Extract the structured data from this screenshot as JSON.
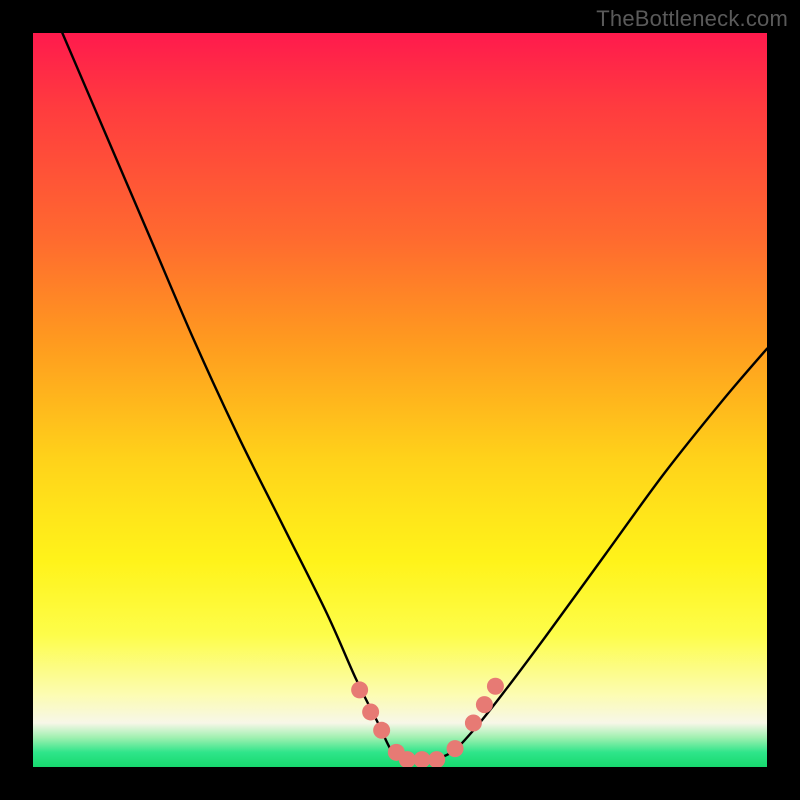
{
  "watermark": "TheBottleneck.com",
  "chart_data": {
    "type": "line",
    "title": "",
    "xlabel": "",
    "ylabel": "",
    "xlim": [
      0,
      100
    ],
    "ylim": [
      0,
      100
    ],
    "series": [
      {
        "name": "bottleneck-curve",
        "x": [
          4,
          10,
          16,
          22,
          28,
          34,
          40,
          44,
          47,
          49,
          51,
          54,
          57,
          60,
          64,
          70,
          78,
          86,
          94,
          100
        ],
        "y": [
          100,
          86,
          72,
          58,
          45,
          33,
          21,
          12,
          6,
          2,
          1,
          1,
          2,
          5,
          10,
          18,
          29,
          40,
          50,
          57
        ]
      }
    ],
    "markers": {
      "name": "highlight-dots",
      "color": "#e77a74",
      "points": [
        {
          "x": 44.5,
          "y": 10.5
        },
        {
          "x": 46.0,
          "y": 7.5
        },
        {
          "x": 47.5,
          "y": 5.0
        },
        {
          "x": 49.5,
          "y": 2.0
        },
        {
          "x": 51.0,
          "y": 1.0
        },
        {
          "x": 53.0,
          "y": 1.0
        },
        {
          "x": 55.0,
          "y": 1.0
        },
        {
          "x": 57.5,
          "y": 2.5
        },
        {
          "x": 60.0,
          "y": 6.0
        },
        {
          "x": 61.5,
          "y": 8.5
        },
        {
          "x": 63.0,
          "y": 11.0
        }
      ]
    },
    "background_gradient": [
      {
        "stop": 0.0,
        "color": "#ff1a4d"
      },
      {
        "stop": 0.28,
        "color": "#ff6a2f"
      },
      {
        "stop": 0.58,
        "color": "#ffd21a"
      },
      {
        "stop": 0.9,
        "color": "#fcfcb0"
      },
      {
        "stop": 0.96,
        "color": "#9ff0b0"
      },
      {
        "stop": 1.0,
        "color": "#17d96e"
      }
    ]
  }
}
